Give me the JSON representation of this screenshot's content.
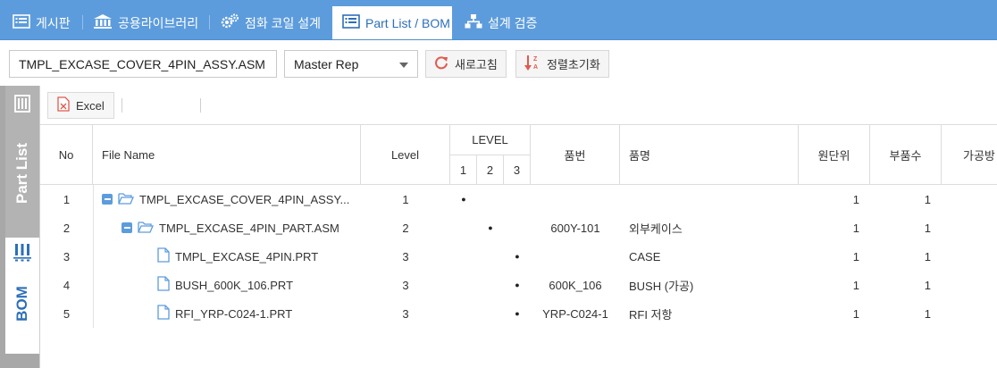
{
  "tabs": [
    {
      "label": "게시판",
      "icon": "board-icon"
    },
    {
      "label": "공용라이브러리",
      "icon": "library-icon"
    },
    {
      "label": "점화 코일 설계",
      "icon": "gears-icon"
    },
    {
      "label": "Part List / BOM",
      "icon": "list-icon",
      "active": true
    },
    {
      "label": "설계 검증",
      "icon": "tree-icon"
    }
  ],
  "toolbar": {
    "file_name": "TMPL_EXCASE_COVER_4PIN_ASSY.ASM",
    "rep_select": "Master Rep",
    "refresh_label": "새로고침",
    "sort_reset_label": "정렬초기화"
  },
  "sidebar": {
    "part_list_label": "Part List",
    "bom_label": "BOM"
  },
  "grid_toolbar": {
    "excel_label": "Excel"
  },
  "columns": {
    "no": "No",
    "file_name": "File Name",
    "level": "Level",
    "level_group": "LEVEL",
    "level_1": "1",
    "level_2": "2",
    "level_3": "3",
    "part_no": "품번",
    "part_name": "품명",
    "unit": "원단위",
    "qty": "부품수",
    "process": "가공방"
  },
  "rows": [
    {
      "no": "1",
      "file": "TMPL_EXCASE_COVER_4PIN_ASSY...",
      "level": "1",
      "dot_level": 1,
      "part_no": "",
      "part_name": "",
      "unit": "1",
      "qty": "1",
      "kind": "asm",
      "indent": 0
    },
    {
      "no": "2",
      "file": "TMPL_EXCASE_4PIN_PART.ASM",
      "level": "2",
      "dot_level": 2,
      "part_no": "600Y-101",
      "part_name": "외부케이스",
      "unit": "1",
      "qty": "1",
      "kind": "asm",
      "indent": 1
    },
    {
      "no": "3",
      "file": "TMPL_EXCASE_4PIN.PRT",
      "level": "3",
      "dot_level": 3,
      "part_no": "",
      "part_name": "CASE",
      "unit": "1",
      "qty": "1",
      "kind": "prt",
      "indent": 2
    },
    {
      "no": "4",
      "file": "BUSH_600K_106.PRT",
      "level": "3",
      "dot_level": 3,
      "part_no": "600K_106",
      "part_name": "BUSH (가공)",
      "unit": "1",
      "qty": "1",
      "kind": "prt",
      "indent": 2
    },
    {
      "no": "5",
      "file": "RFI_YRP-C024-1.PRT",
      "level": "3",
      "dot_level": 3,
      "part_no": "YRP-C024-1",
      "part_name": "RFI 저항",
      "unit": "1",
      "qty": "1",
      "kind": "prt",
      "indent": 2
    }
  ],
  "dot_symbol": "●"
}
